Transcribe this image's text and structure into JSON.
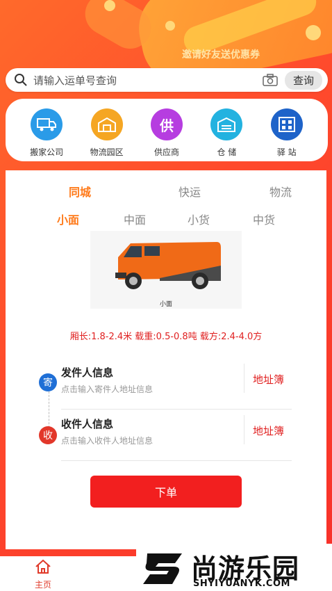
{
  "promo_text": "邀请好友送优惠券",
  "search": {
    "placeholder": "请输入运单号查询",
    "button_label": "查询"
  },
  "categories": [
    {
      "label": "搬家公司",
      "icon": "moving-truck-icon",
      "color": "#2a9be8"
    },
    {
      "label": "物流园区",
      "icon": "logistics-park-icon",
      "color": "#f5a623"
    },
    {
      "label": "供应商",
      "icon": "supplier-icon",
      "color": "#b63de0",
      "glyph": "供"
    },
    {
      "label": "仓 储",
      "icon": "warehouse-icon",
      "color": "#23b2e0"
    },
    {
      "label": "驿 站",
      "icon": "station-icon",
      "color": "#1e63c9"
    }
  ],
  "service_tabs": [
    "同城",
    "快运",
    "物流"
  ],
  "vehicle_tabs": [
    "小面",
    "中面",
    "小货",
    "中货"
  ],
  "vehicle": {
    "caption": "小面"
  },
  "spec_text": "厢长:1.8-2.4米 载重:0.5-0.8吨 载方:2.4-4.0方",
  "sender": {
    "badge": "寄",
    "title": "发件人信息",
    "hint": "点击输入寄件人地址信息",
    "address_book": "地址簿"
  },
  "receiver": {
    "badge": "收",
    "title": "收件人信息",
    "hint": "点击输入收件人地址信息",
    "address_book": "地址簿"
  },
  "submit_label": "下单",
  "bottom_nav": {
    "home_label": "主页"
  },
  "watermark": {
    "cn": "尚游乐园",
    "en": "SHYIYUANYK.COM"
  },
  "colors": {
    "accent": "#ff7a1a",
    "red": "#f21f1f",
    "hero": "#ff4a2c"
  }
}
